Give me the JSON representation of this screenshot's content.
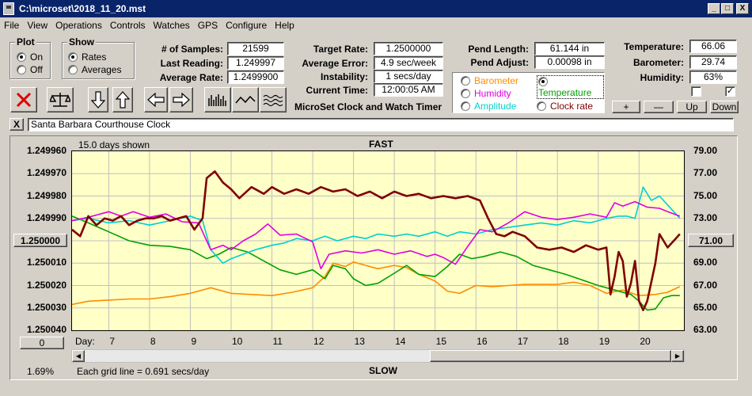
{
  "window": {
    "title": "C:\\microset\\2018_11_20.mst",
    "minimize": "_",
    "maximize": "□",
    "close": "X"
  },
  "menu": [
    "File",
    "View",
    "Operations",
    "Controls",
    "Watches",
    "GPS",
    "Configure",
    "Help"
  ],
  "plot_group": {
    "title": "Plot",
    "options": [
      {
        "label": "On",
        "selected": true
      },
      {
        "label": "Off",
        "selected": false
      }
    ]
  },
  "show_group": {
    "title": "Show",
    "options": [
      {
        "label": "Rates",
        "selected": true
      },
      {
        "label": "Averages",
        "selected": false
      }
    ]
  },
  "stats": {
    "samples_label": "# of Samples:",
    "samples_value": "21599",
    "last_reading_label": "Last Reading:",
    "last_reading_value": "1.249997",
    "avg_rate_label": "Average Rate:",
    "avg_rate_value": "1.2499900",
    "target_rate_label": "Target Rate:",
    "target_rate_value": "1.2500000",
    "avg_error_label": "Average Error:",
    "avg_error_value": "4.9 sec/week",
    "instability_label": "Instability:",
    "instability_value": "1 secs/day",
    "current_time_label": "Current Time:",
    "current_time_value": "12:00:05 AM",
    "pend_length_label": "Pend Length:",
    "pend_length_value": "61.144 in",
    "pend_adjust_label": "Pend Adjust:",
    "pend_adjust_value": "0.00098 in",
    "temperature_label": "Temperature:",
    "temperature_value": "66.06",
    "barometer_label": "Barometer:",
    "barometer_value": "29.74",
    "humidity_label": "Humidity:",
    "humidity_value": "63%"
  },
  "app_caption": "MicroSet Clock and Watch Timer",
  "series_selector": [
    {
      "label": "Barometer",
      "color": "#ff8c00",
      "selected": false
    },
    {
      "label": "Temperature",
      "color": "#00a000",
      "selected": true
    },
    {
      "label": "Humidity",
      "color": "#e000e0",
      "selected": false
    },
    {
      "label": "Amplitude",
      "color": "#00d0d0",
      "selected": false
    },
    {
      "label": "Clock rate",
      "color": "#800000",
      "selected": false
    }
  ],
  "right_buttons": {
    "plus": "+",
    "minus": "—",
    "up": "Up",
    "down": "Down"
  },
  "checkboxes": [
    {
      "checked": false
    },
    {
      "checked": true
    }
  ],
  "note_x": "X",
  "note_text": "Santa Barbara Courthouse Clock",
  "chart_data": {
    "type": "line",
    "top_label": "15.0 days shown",
    "fast_label": "FAST",
    "slow_label": "SLOW",
    "grid_note": "Each grid line = 0.691 secs/day",
    "left_axis": {
      "ticks": [
        "1.249960",
        "1.249970",
        "1.249980",
        "1.249990",
        "1.250000",
        "1.250010",
        "1.250020",
        "1.250030",
        "1.250040"
      ],
      "range": [
        1.24996,
        1.25004
      ],
      "inverted": true,
      "highlight_tick": "1.250000"
    },
    "right_axis": {
      "ticks": [
        "79.00",
        "77.00",
        "75.00",
        "73.00",
        "71.00",
        "69.00",
        "67.00",
        "65.00",
        "63.00"
      ],
      "range": [
        63,
        79
      ],
      "highlight_tick": "71.00"
    },
    "x_axis": {
      "prefix": "Day:",
      "ticks": [
        7,
        8,
        9,
        10,
        11,
        12,
        13,
        14,
        15,
        16,
        17,
        18,
        19,
        20
      ],
      "range": [
        6.1,
        21.1
      ]
    },
    "left_bottom_button": "0",
    "percent_label": "1.69%",
    "series": [
      {
        "name": "Clock rate",
        "color": "#800000",
        "x": [
          6.1,
          6.3,
          6.5,
          6.7,
          6.9,
          7.1,
          7.3,
          7.5,
          7.7,
          7.9,
          8.1,
          8.3,
          8.5,
          8.7,
          8.9,
          9.1,
          9.3,
          9.4,
          9.6,
          9.8,
          10.0,
          10.2,
          10.5,
          10.8,
          11.0,
          11.3,
          11.6,
          11.9,
          12.2,
          12.5,
          12.8,
          13.1,
          13.4,
          13.7,
          14.0,
          14.3,
          14.6,
          14.9,
          15.2,
          15.5,
          15.8,
          16.1,
          16.3,
          16.5,
          16.7,
          16.9,
          17.2,
          17.5,
          17.8,
          18.1,
          18.4,
          18.7,
          19.0,
          19.2,
          19.3,
          19.4,
          19.5,
          19.6,
          19.7,
          19.8,
          19.9,
          20.0,
          20.1,
          20.2,
          20.4,
          20.5,
          20.7,
          20.9,
          21.0
        ],
        "values": [
          1.249995,
          1.249998,
          1.249989,
          1.249993,
          1.24999,
          1.249991,
          1.249989,
          1.249993,
          1.249991,
          1.24999,
          1.24999,
          1.249989,
          1.249991,
          1.24999,
          1.249989,
          1.249995,
          1.24999,
          1.249972,
          1.249969,
          1.249974,
          1.249977,
          1.249981,
          1.249976,
          1.249979,
          1.249976,
          1.249979,
          1.249977,
          1.249979,
          1.249976,
          1.249978,
          1.249977,
          1.24998,
          1.249978,
          1.249981,
          1.249978,
          1.24998,
          1.249979,
          1.249981,
          1.24998,
          1.249981,
          1.24998,
          1.249982,
          1.24999,
          1.249997,
          1.249998,
          1.249996,
          1.249998,
          1.250003,
          1.250004,
          1.250003,
          1.250005,
          1.250002,
          1.250004,
          1.250003,
          1.250024,
          1.250016,
          1.250005,
          1.250009,
          1.250025,
          1.250019,
          1.250009,
          1.250027,
          1.250031,
          1.250027,
          1.25001,
          1.249997,
          1.250003,
          1.249999,
          1.249997
        ]
      },
      {
        "name": "Amplitude",
        "color": "#00d0d0",
        "x": [
          6.1,
          6.5,
          7.0,
          7.5,
          8.0,
          8.5,
          9.0,
          9.3,
          9.5,
          9.8,
          10.0,
          10.3,
          10.6,
          11.0,
          11.3,
          11.6,
          12.0,
          12.3,
          12.6,
          13.0,
          13.3,
          13.6,
          14.0,
          14.3,
          14.6,
          15.0,
          15.3,
          15.6,
          16.0,
          16.4,
          16.8,
          17.2,
          17.6,
          18.0,
          18.4,
          18.8,
          19.2,
          19.5,
          19.7,
          19.9,
          20.1,
          20.3,
          20.5,
          20.7,
          20.9,
          21.0
        ],
        "values": [
          1.249991,
          1.24999,
          1.249992,
          1.249991,
          1.249993,
          1.249991,
          1.249989,
          1.249991,
          1.250004,
          1.25001,
          1.250008,
          1.250006,
          1.250004,
          1.250002,
          1.250001,
          1.249999,
          1.25,
          1.249998,
          1.25,
          1.249998,
          1.249999,
          1.249997,
          1.249998,
          1.249997,
          1.249998,
          1.249996,
          1.249998,
          1.249996,
          1.249997,
          1.249995,
          1.249994,
          1.249993,
          1.249992,
          1.249993,
          1.249991,
          1.249992,
          1.24999,
          1.249989,
          1.249989,
          1.24999,
          1.249976,
          1.249982,
          1.24998,
          1.249984,
          1.249988,
          1.24999
        ]
      },
      {
        "name": "Humidity",
        "color": "#e000e0",
        "x": [
          6.1,
          6.5,
          7.0,
          7.3,
          7.6,
          8.0,
          8.4,
          8.8,
          9.2,
          9.5,
          9.8,
          10.0,
          10.3,
          10.6,
          10.9,
          11.2,
          11.6,
          12.0,
          12.2,
          12.4,
          12.8,
          13.2,
          13.6,
          14.0,
          14.4,
          14.8,
          15.0,
          15.2,
          15.5,
          15.8,
          16.1,
          16.4,
          16.8,
          17.2,
          17.6,
          18.0,
          18.4,
          18.8,
          19.2,
          19.4,
          19.6,
          19.9,
          20.2,
          20.5,
          20.7,
          21.0
        ],
        "values": [
          72.8,
          73.1,
          73.6,
          73.2,
          73.6,
          73.1,
          73.4,
          72.7,
          72.6,
          70.2,
          70.6,
          70.2,
          71.0,
          71.6,
          72.5,
          71.5,
          71.6,
          70.9,
          68.5,
          69.8,
          70.1,
          69.9,
          70.2,
          69.8,
          70.1,
          69.6,
          69.8,
          69.5,
          68.9,
          70.5,
          72.0,
          71.8,
          72.6,
          73.6,
          73.1,
          72.9,
          73.1,
          73.4,
          73.1,
          74.4,
          74.1,
          74.5,
          74.0,
          73.9,
          73.6,
          73.2
        ]
      },
      {
        "name": "Temperature",
        "color": "#00a000",
        "x": [
          6.1,
          6.5,
          7.0,
          7.5,
          8.0,
          8.5,
          9.0,
          9.4,
          9.7,
          10.0,
          10.4,
          10.8,
          11.2,
          11.6,
          12.0,
          12.3,
          12.5,
          12.8,
          13.0,
          13.3,
          13.6,
          14.0,
          14.3,
          14.6,
          15.0,
          15.3,
          15.6,
          15.9,
          16.2,
          16.6,
          17.0,
          17.4,
          17.8,
          18.2,
          18.6,
          19.0,
          19.4,
          19.8,
          20.0,
          20.2,
          20.4,
          20.6,
          20.8,
          21.0
        ],
        "values": [
          73.2,
          72.6,
          71.8,
          71.0,
          70.6,
          70.5,
          70.2,
          69.4,
          69.8,
          70.4,
          70.0,
          69.2,
          68.4,
          68.0,
          68.4,
          67.6,
          68.8,
          68.5,
          67.6,
          67.0,
          67.2,
          68.1,
          68.8,
          68.0,
          67.8,
          68.7,
          69.8,
          69.4,
          69.6,
          70.0,
          69.6,
          68.8,
          68.4,
          68.0,
          67.5,
          67.0,
          66.6,
          66.2,
          65.6,
          64.8,
          64.9,
          65.9,
          66.1,
          66.1
        ]
      },
      {
        "name": "Barometer",
        "color": "#ff8c00",
        "x": [
          6.1,
          6.5,
          7.0,
          7.5,
          8.0,
          8.5,
          9.0,
          9.5,
          10.0,
          10.5,
          11.0,
          11.5,
          12.0,
          12.3,
          12.5,
          12.8,
          13.0,
          13.3,
          13.6,
          14.0,
          14.3,
          14.6,
          15.0,
          15.3,
          15.6,
          16.0,
          16.4,
          16.8,
          17.2,
          17.6,
          18.0,
          18.4,
          18.8,
          19.2,
          19.6,
          20.0,
          20.4,
          20.7,
          21.0
        ],
        "values": [
          65.3,
          65.6,
          65.7,
          65.8,
          65.8,
          66.0,
          66.3,
          66.8,
          66.3,
          66.2,
          66.1,
          66.4,
          66.8,
          67.8,
          69.0,
          68.7,
          69.1,
          68.8,
          68.5,
          68.8,
          68.6,
          68.0,
          67.4,
          66.5,
          66.3,
          67.0,
          66.9,
          67.0,
          67.1,
          67.1,
          67.1,
          67.3,
          67.0,
          66.3,
          66.6,
          66.1,
          66.2,
          66.4,
          66.9
        ]
      }
    ]
  }
}
